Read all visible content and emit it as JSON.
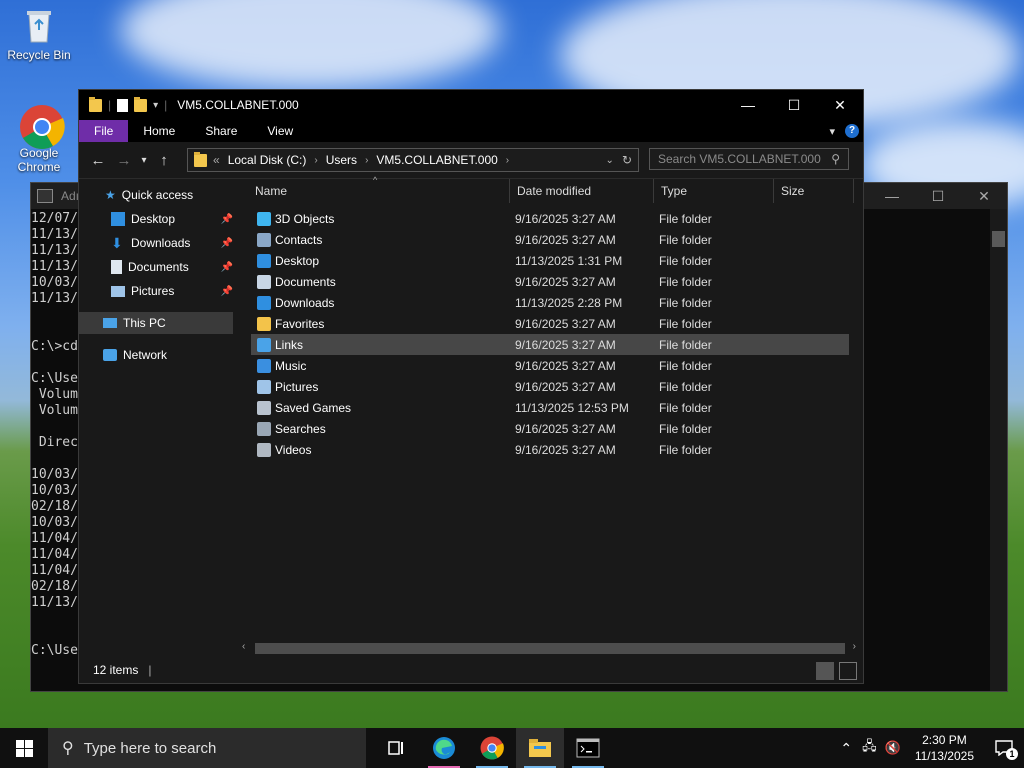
{
  "desktop": {
    "icons": [
      {
        "label": "Recycle Bin"
      },
      {
        "label": "Google Chrome"
      }
    ]
  },
  "cmd": {
    "title": "Adı",
    "lines": [
      "12/07/",
      "11/13/",
      "11/13/",
      "11/13/",
      "10/03/",
      "11/13/",
      "",
      "",
      "C:\\>cd",
      "",
      "C:\\Use",
      " Volum",
      " Volum",
      "",
      " Direc",
      "",
      "10/03/",
      "10/03/",
      "02/18/",
      "10/03/",
      "11/04/",
      "11/04/",
      "11/04/",
      "02/18/",
      "11/13/",
      "",
      "",
      "C:\\Users>"
    ]
  },
  "explorer": {
    "title": "VM5.COLLABNET.000",
    "window_controls": {
      "minimize": "—",
      "maximize": "☐",
      "close": "✕"
    },
    "ribbon_tabs": [
      "File",
      "Home",
      "Share",
      "View"
    ],
    "address": {
      "overflow": "«",
      "crumbs": [
        "Local Disk (C:)",
        "Users",
        "VM5.COLLABNET.000"
      ]
    },
    "search_placeholder": "Search VM5.COLLABNET.000",
    "nav_pane": {
      "quick_access": "Quick access",
      "pinned": [
        "Desktop",
        "Downloads",
        "Documents",
        "Pictures"
      ],
      "this_pc": "This PC",
      "network": "Network"
    },
    "columns": [
      "Name",
      "Date modified",
      "Type",
      "Size"
    ],
    "files": [
      {
        "name": "3D Objects",
        "date": "9/16/2025 3:27 AM",
        "type": "File folder",
        "icon_color": "#3fb6f0"
      },
      {
        "name": "Contacts",
        "date": "9/16/2025 3:27 AM",
        "type": "File folder",
        "icon_color": "#8aa7c7"
      },
      {
        "name": "Desktop",
        "date": "11/13/2025 1:31 PM",
        "type": "File folder",
        "icon_color": "#2f8fe0"
      },
      {
        "name": "Documents",
        "date": "9/16/2025 3:27 AM",
        "type": "File folder",
        "icon_color": "#c8d6e5"
      },
      {
        "name": "Downloads",
        "date": "11/13/2025 2:28 PM",
        "type": "File folder",
        "icon_color": "#2f8fe0"
      },
      {
        "name": "Favorites",
        "date": "9/16/2025 3:27 AM",
        "type": "File folder",
        "icon_color": "#f3c34a"
      },
      {
        "name": "Links",
        "date": "9/16/2025 3:27 AM",
        "type": "File folder",
        "icon_color": "#4aa3e8"
      },
      {
        "name": "Music",
        "date": "9/16/2025 3:27 AM",
        "type": "File folder",
        "icon_color": "#3a8fe0"
      },
      {
        "name": "Pictures",
        "date": "9/16/2025 3:27 AM",
        "type": "File folder",
        "icon_color": "#9fc4e8"
      },
      {
        "name": "Saved Games",
        "date": "11/13/2025 12:53 PM",
        "type": "File folder",
        "icon_color": "#b9c3cf"
      },
      {
        "name": "Searches",
        "date": "9/16/2025 3:27 AM",
        "type": "File folder",
        "icon_color": "#9aa7b5"
      },
      {
        "name": "Videos",
        "date": "9/16/2025 3:27 AM",
        "type": "File folder",
        "icon_color": "#b0b8c2"
      }
    ],
    "selected_index": 6,
    "status": "12 items"
  },
  "taskbar": {
    "search_placeholder": "Type here to search",
    "time": "2:30 PM",
    "date": "11/13/2025",
    "notification_count": "1"
  },
  "colors": {
    "file_tab": "#6f2da8",
    "selection": "#474747",
    "accent": "#76b9ed"
  }
}
